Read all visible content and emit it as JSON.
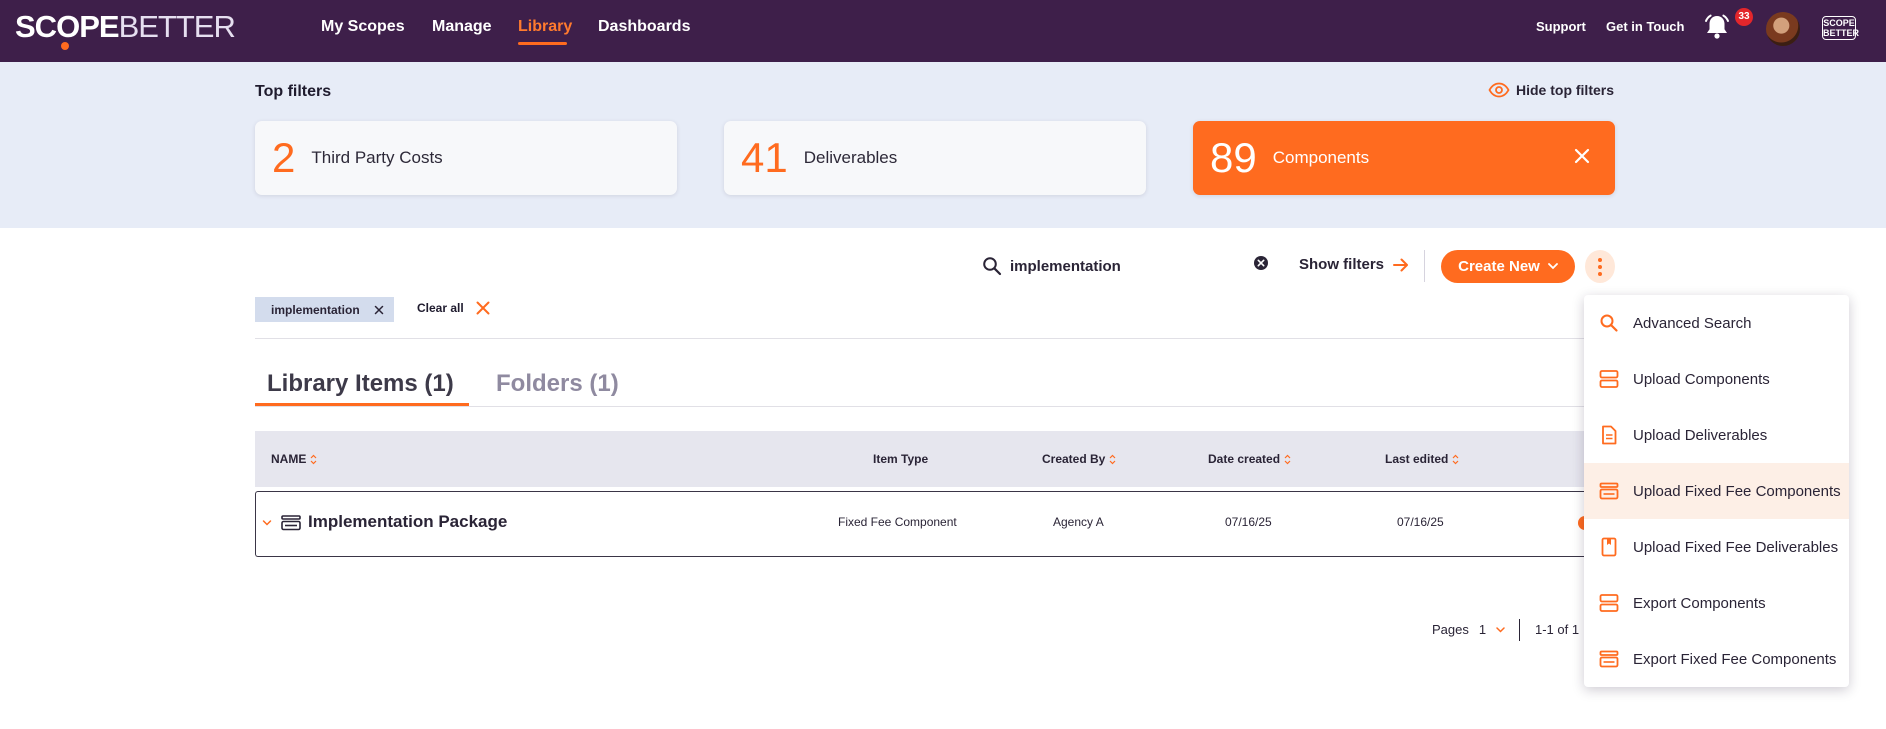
{
  "nav": {
    "logo_scope": "SC",
    "logo_o": "O",
    "logo_pe": "PE",
    "logo_better": "BETTER",
    "items": [
      {
        "label": "My Scopes"
      },
      {
        "label": "Manage"
      },
      {
        "label": "Library"
      },
      {
        "label": "Dashboards"
      }
    ],
    "support": "Support",
    "get_in_touch": "Get in Touch",
    "notification_count": "33",
    "mini_logo_top": "SCOPE",
    "mini_logo_bottom": "BETTER"
  },
  "filters": {
    "title": "Top filters",
    "hide_label": "Hide top filters",
    "cards": [
      {
        "count": "2",
        "label": "Third Party Costs"
      },
      {
        "count": "41",
        "label": "Deliverables"
      },
      {
        "count": "89",
        "label": "Components"
      }
    ]
  },
  "search": {
    "value": "implementation",
    "show_filters": "Show filters",
    "create_new": "Create New"
  },
  "chips": {
    "active": "implementation",
    "clear_all": "Clear all"
  },
  "tabs": {
    "library": "Library Items (1)",
    "folders": "Folders (1)"
  },
  "table": {
    "headers": {
      "name": "NAME",
      "item_type": "Item Type",
      "created_by": "Created By",
      "date_created": "Date created",
      "last_edited": "Last edited"
    },
    "rows": [
      {
        "name": "Implementation Package",
        "item_type": "Fixed Fee Component",
        "created_by": "Agency A",
        "date_created": "07/16/25",
        "last_edited": "07/16/25"
      }
    ]
  },
  "pagination": {
    "pages_label": "Pages",
    "page": "1",
    "range": "1-1 of 1"
  },
  "menu": {
    "items": [
      {
        "label": "Advanced Search",
        "icon": "search-icon"
      },
      {
        "label": "Upload Components",
        "icon": "component-stack-icon"
      },
      {
        "label": "Upload Deliverables",
        "icon": "document-icon"
      },
      {
        "label": "Upload Fixed Fee Components",
        "icon": "fixed-fee-icon"
      },
      {
        "label": "Upload Fixed Fee Deliverables",
        "icon": "bookmark-doc-icon"
      },
      {
        "label": "Export Components",
        "icon": "component-stack-icon"
      },
      {
        "label": "Export Fixed Fee Components",
        "icon": "fixed-fee-icon"
      }
    ]
  },
  "colors": {
    "nav_bg": "#3e1f4a",
    "accent": "#ff6b1f",
    "filters_bg": "#e7ecf7"
  }
}
